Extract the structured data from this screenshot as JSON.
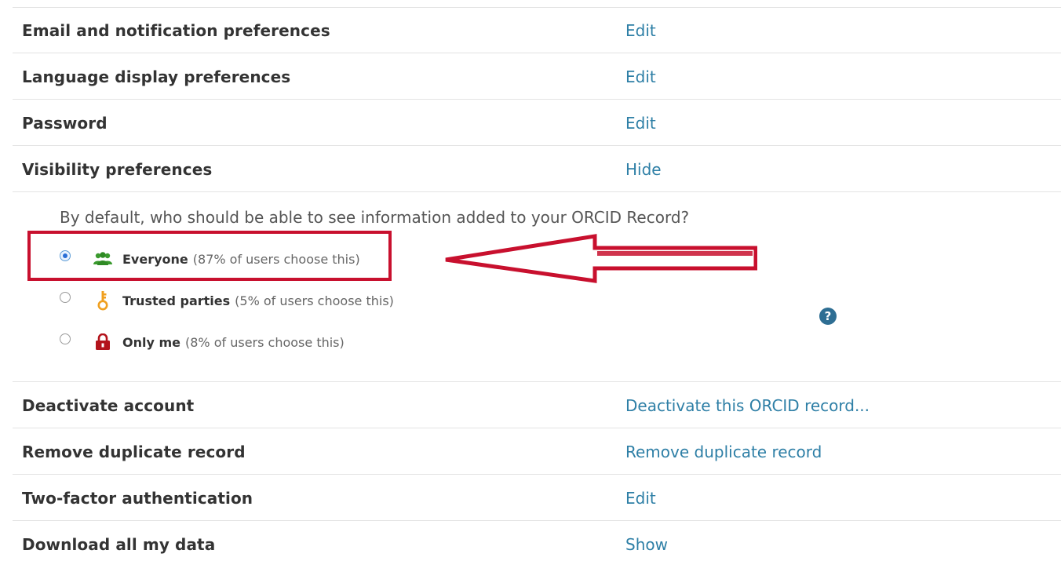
{
  "settings_rows_top": [
    {
      "label": "Email and notification preferences",
      "action": "Edit"
    },
    {
      "label": "Language display preferences",
      "action": "Edit"
    },
    {
      "label": "Password",
      "action": "Edit"
    },
    {
      "label": "Visibility preferences",
      "action": "Hide"
    }
  ],
  "visibility": {
    "question": "By default, who should be able to see information added to your ORCID Record?",
    "options": [
      {
        "name": "Everyone",
        "percent": "(87% of users choose this)",
        "selected": true,
        "icon": "users-group-icon",
        "icon_color": "#3a9a2e"
      },
      {
        "name": "Trusted parties",
        "percent": "(5% of users choose this)",
        "selected": false,
        "icon": "key-icon",
        "icon_color": "#f0a020"
      },
      {
        "name": "Only me",
        "percent": "(8% of users choose this)",
        "selected": false,
        "icon": "lock-icon",
        "icon_color": "#b3131b"
      }
    ],
    "help_icon": "?"
  },
  "settings_rows_bottom": [
    {
      "label": "Deactivate account",
      "action": "Deactivate this ORCID record..."
    },
    {
      "label": "Remove duplicate record",
      "action": "Remove duplicate record"
    },
    {
      "label": "Two-factor authentication",
      "action": "Edit"
    },
    {
      "label": "Download all my data",
      "action": "Show"
    }
  ],
  "colors": {
    "link": "#2e7fa6",
    "annotation_red": "#c8102e",
    "help_icon_bg": "#2e6e93"
  }
}
